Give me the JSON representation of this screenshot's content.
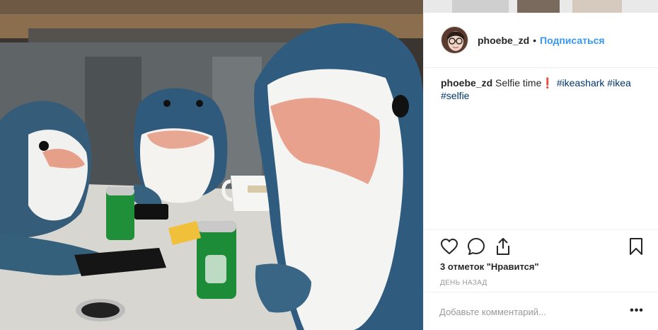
{
  "post": {
    "username": "phoebe_zd",
    "separator": "•",
    "follow_label": "Подписаться",
    "caption": {
      "username": "phoebe_zd",
      "text": " Selfie time❗ ",
      "tags": [
        "#ikeashark",
        "#ikea",
        "#selfie"
      ]
    },
    "likes_text": "3 отметок \"Нравится\"",
    "timestamp": "ДЕНЬ НАЗАД",
    "comment_placeholder": "Добавьте комментарий...",
    "more_label": "•••"
  },
  "icons": {
    "like": "heart-icon",
    "comment": "comment-icon",
    "share": "share-icon",
    "save": "bookmark-icon",
    "more": "more-options-icon"
  },
  "colors": {
    "link": "#3897f0",
    "hashtag": "#003569",
    "muted": "#999999"
  }
}
